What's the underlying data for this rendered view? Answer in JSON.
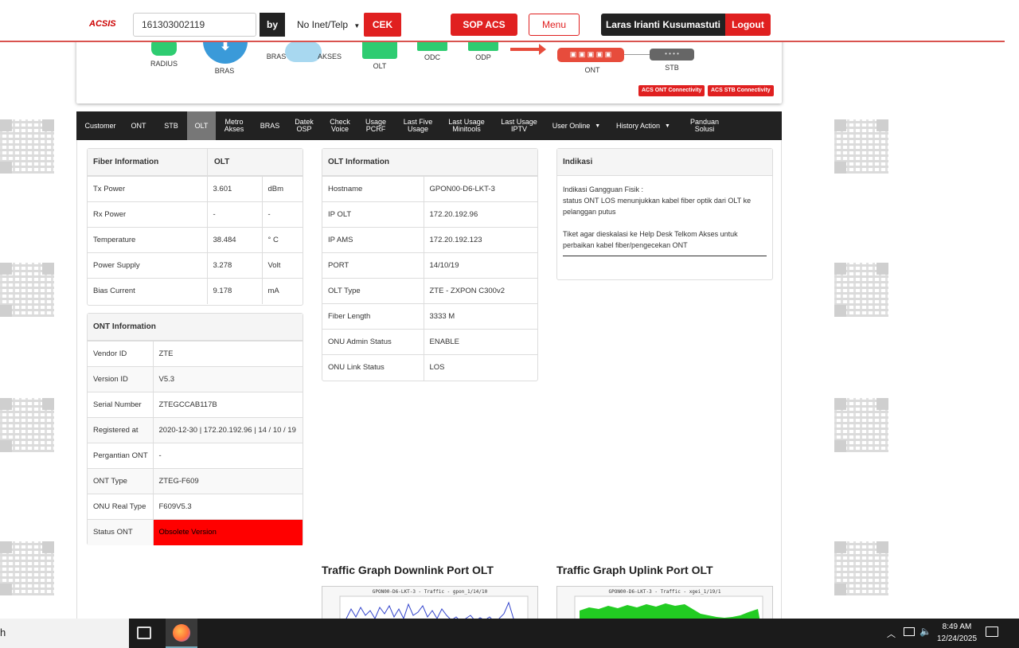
{
  "header": {
    "logo": "ACSIS",
    "search_value": "161303002119",
    "by_label": "by",
    "by_select": "No Inet/Telp",
    "cek_label": "CEK",
    "sop_label": "SOP ACS",
    "menu_label": "Menu",
    "user_name": "Laras Irianti Kusumastuti",
    "logout_label": "Logout"
  },
  "diagram": {
    "nodes": [
      "RADIUS",
      "BRAS",
      "BRAS",
      "AKSES",
      "OLT",
      "ODC",
      "ODP",
      "ONT",
      "STB"
    ],
    "acs_ont": "ACS ONT Connectivity",
    "acs_stb": "ACS STB Connectivity"
  },
  "tabs": [
    {
      "label": "Customer"
    },
    {
      "label": "ONT"
    },
    {
      "label": "STB"
    },
    {
      "label": "OLT"
    },
    {
      "label": "Metro Akses"
    },
    {
      "label": "BRAS"
    },
    {
      "label": "Datek OSP"
    },
    {
      "label": "Check Voice"
    },
    {
      "label": "Usage PCRF"
    },
    {
      "label": "Last Five Usage"
    },
    {
      "label": "Last Usage Minitools"
    },
    {
      "label": "Last Usage IPTV"
    },
    {
      "label": "User Online"
    },
    {
      "label": "History Action"
    },
    {
      "label": "Panduan Solusi"
    }
  ],
  "fiber": {
    "title": "Fiber Information",
    "col_title": "OLT",
    "rows": [
      {
        "label": "Tx Power",
        "value": "3.601",
        "unit": "dBm"
      },
      {
        "label": "Rx Power",
        "value": "-",
        "unit": "-"
      },
      {
        "label": "Temperature",
        "value": "38.484",
        "unit": "° C"
      },
      {
        "label": "Power Supply",
        "value": "3.278",
        "unit": "Volt"
      },
      {
        "label": "Bias Current",
        "value": "9.178",
        "unit": "mA"
      }
    ]
  },
  "ont": {
    "title": "ONT Information",
    "rows": [
      {
        "label": "Vendor ID",
        "value": "ZTE"
      },
      {
        "label": "Version ID",
        "value": "V5.3"
      },
      {
        "label": "Serial Number",
        "value": "ZTEGCCAB117B"
      },
      {
        "label": "Registered at",
        "value": "2020-12-30 | 172.20.192.96 | 14 / 10 / 19"
      },
      {
        "label": "Pergantian ONT",
        "value": "-"
      },
      {
        "label": "ONT Type",
        "value": "ZTEG-F609"
      },
      {
        "label": "ONU Real Type",
        "value": "F609V5.3"
      },
      {
        "label": "Status ONT",
        "value": "Obsolete Version"
      }
    ],
    "status_color": "#ff0000"
  },
  "olt": {
    "title": "OLT Information",
    "rows": [
      {
        "label": "Hostname",
        "value": "GPON00-D6-LKT-3"
      },
      {
        "label": "IP OLT",
        "value": "172.20.192.96"
      },
      {
        "label": "IP AMS",
        "value": "172.20.192.123"
      },
      {
        "label": "PORT",
        "value": "14/10/19"
      },
      {
        "label": "OLT Type",
        "value": "ZTE - ZXPON C300v2"
      },
      {
        "label": "Fiber Length",
        "value": "3333 M"
      },
      {
        "label": "ONU Admin Status",
        "value": "ENABLE"
      },
      {
        "label": "ONU Link Status",
        "value": "LOS"
      }
    ]
  },
  "indikasi": {
    "title": "Indikasi",
    "line1": "Indikasi Gangguan Fisik :",
    "line2": "status ONT LOS menunjukkan kabel fiber optik dari OLT ke pelanggan putus",
    "line3": "Tiket agar dieskalasi ke Help Desk Telkom Akses untuk perbaikan kabel fiber/pengecekan ONT"
  },
  "graphs": {
    "downlink_title": "Traffic Graph Downlink Port OLT",
    "downlink_caption": "GPON00-D6-LKT-3 - Traffic - gpon_1/14/10",
    "uplink_title": "Traffic Graph Uplink Port OLT",
    "uplink_caption": "GPON00-D6-LKT-3 - Traffic - xgei_1/19/1"
  },
  "taskbar": {
    "search_text": "h",
    "time": "8:49 AM",
    "date": "12/24/2025"
  },
  "colors": {
    "brand_red": "#e02020",
    "tab_bar": "#222222",
    "olt_green": "#2ecc71"
  }
}
